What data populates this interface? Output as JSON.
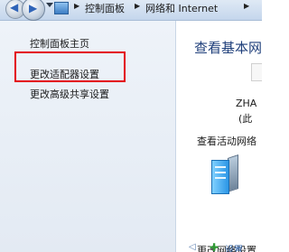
{
  "breadcrumb": {
    "items": [
      "控制面板",
      "网络和 Internet"
    ]
  },
  "sidebar": {
    "items": [
      {
        "label": "控制面板主页"
      },
      {
        "label": "更改适配器设置"
      },
      {
        "label": "更改高级共享设置"
      }
    ]
  },
  "main": {
    "title": "查看基本网",
    "network_name": "ZHA",
    "network_sub": "(此",
    "section_label": "查看活动网络",
    "change_label": "更改网络设置",
    "bottom_link": "设置"
  },
  "colors": {
    "highlight": "#e3000f",
    "title": "#1e3e7a",
    "pane": "#e9eff7"
  },
  "icons": [
    "back-arrow-icon",
    "forward-arrow-icon",
    "dropdown-icon",
    "control-panel-icon",
    "server-icon",
    "add-icon"
  ]
}
